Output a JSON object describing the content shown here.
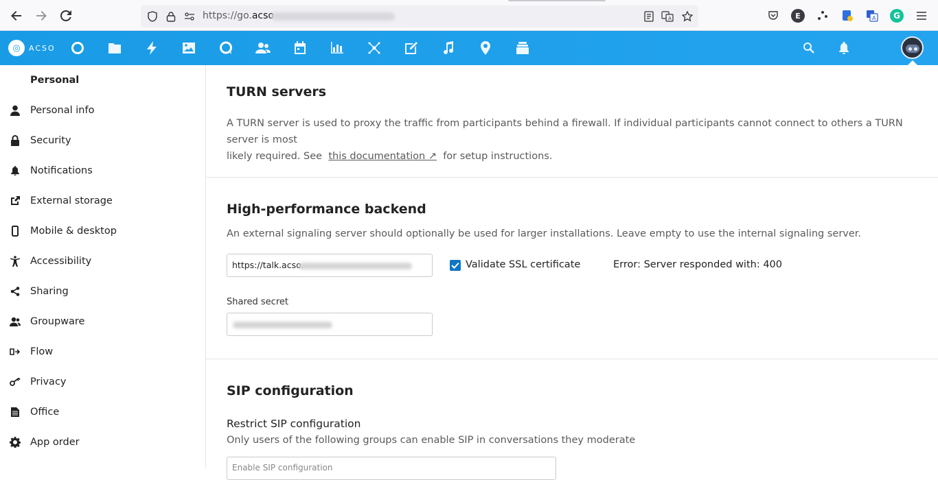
{
  "browser": {
    "url_prefix": "https://go.",
    "url_domain": "acso",
    "back_icon": "back-arrow-icon",
    "forward_icon": "forward-arrow-icon",
    "reload_icon": "reload-icon"
  },
  "header": {
    "logo_text": "ACSO",
    "apps": [
      "dashboard",
      "files",
      "activity",
      "photos",
      "talk",
      "contacts",
      "calendar",
      "analytics",
      "deck",
      "notes",
      "music",
      "maps",
      "stacks"
    ]
  },
  "sidebar": {
    "heading": "Personal",
    "items": [
      {
        "label": "Personal info",
        "icon": "user-icon"
      },
      {
        "label": "Security",
        "icon": "lock-icon"
      },
      {
        "label": "Notifications",
        "icon": "bell-icon"
      },
      {
        "label": "External storage",
        "icon": "external-link-icon"
      },
      {
        "label": "Mobile & desktop",
        "icon": "phone-icon"
      },
      {
        "label": "Accessibility",
        "icon": "accessibility-icon"
      },
      {
        "label": "Sharing",
        "icon": "share-icon"
      },
      {
        "label": "Groupware",
        "icon": "group-icon"
      },
      {
        "label": "Flow",
        "icon": "flow-icon"
      },
      {
        "label": "Privacy",
        "icon": "key-icon"
      },
      {
        "label": "Office",
        "icon": "document-icon"
      },
      {
        "label": "App order",
        "icon": "gear-icon"
      }
    ]
  },
  "main": {
    "turn": {
      "title": "TURN servers",
      "text1": "A TURN server is used to proxy the traffic from participants behind a firewall. If individual participants cannot connect to others a TURN server is most",
      "text2_pre": "likely required. See",
      "link": "this documentation ↗",
      "text2_post": "for setup instructions."
    },
    "hpb": {
      "title": "High-performance backend",
      "text": "An external signaling server should optionally be used for larger installations. Leave empty to use the internal signaling server.",
      "server_value": "https://talk.acso.",
      "validate_label": "Validate SSL certificate",
      "validate_checked": true,
      "error": "Error: Server responded with: 400",
      "secret_label": "Shared secret"
    },
    "sip": {
      "title": "SIP configuration",
      "restrict_title": "Restrict SIP configuration",
      "restrict_text": "Only users of the following groups can enable SIP in conversations they moderate",
      "placeholder": "Enable SIP configuration"
    }
  }
}
